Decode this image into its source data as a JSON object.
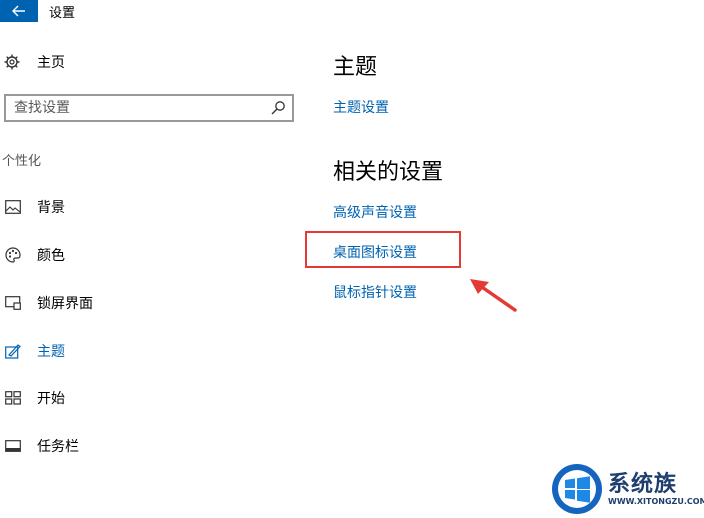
{
  "window": {
    "title": "设置",
    "back_icon": "arrow-left-icon"
  },
  "sidebar": {
    "home_label": "主页",
    "search_placeholder": "查找设置",
    "section_label": "个性化",
    "items": [
      {
        "label": "背景",
        "icon": "picture-icon",
        "active": false
      },
      {
        "label": "颜色",
        "icon": "palette-icon",
        "active": false
      },
      {
        "label": "锁屏界面",
        "icon": "lock-screen-icon",
        "active": false
      },
      {
        "label": "主题",
        "icon": "theme-brush-icon",
        "active": true
      },
      {
        "label": "开始",
        "icon": "start-grid-icon",
        "active": false
      },
      {
        "label": "任务栏",
        "icon": "taskbar-icon",
        "active": false
      }
    ]
  },
  "main": {
    "theme_heading": "主题",
    "theme_link": "主题设置",
    "related_heading": "相关的设置",
    "related_links": [
      "高级声音设置",
      "桌面图标设置",
      "鼠标指针设置"
    ]
  },
  "watermark": {
    "name": "系统族",
    "url": "WWW.XITONGZU.COM"
  },
  "colors": {
    "accent": "#0063b1",
    "highlight": "#e53935"
  }
}
